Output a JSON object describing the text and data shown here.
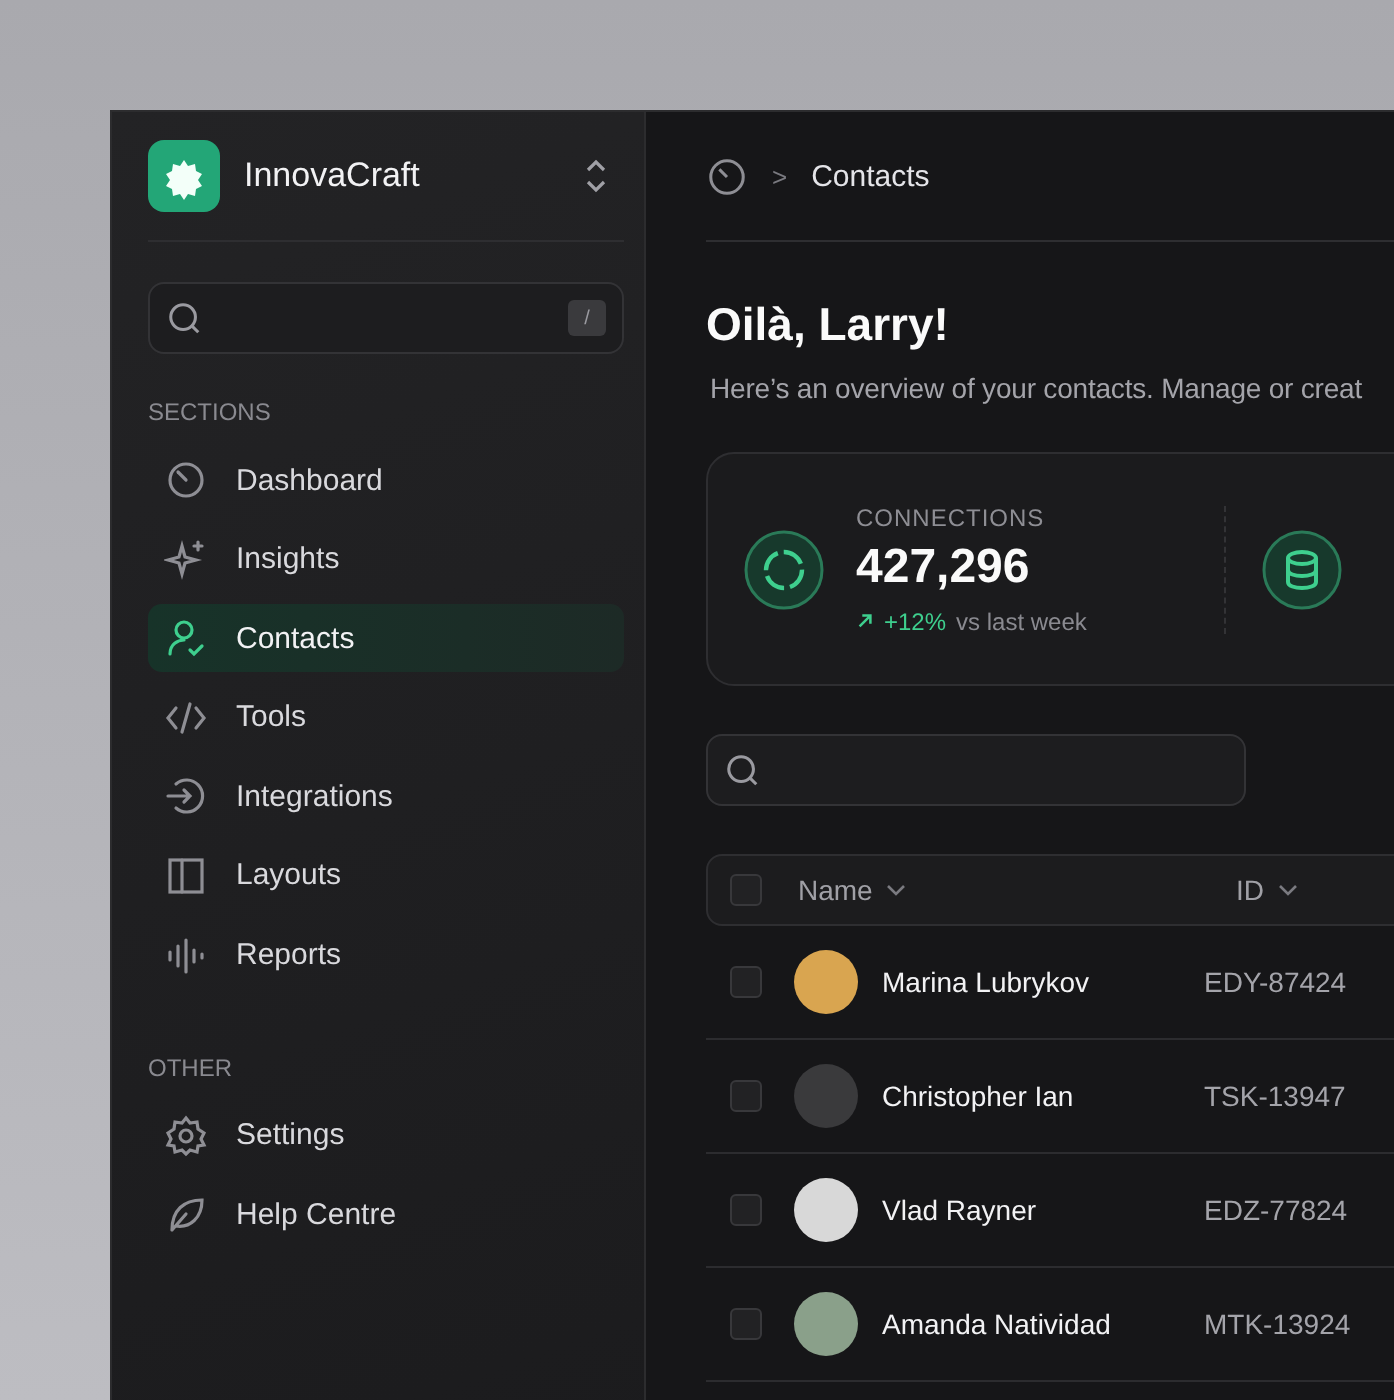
{
  "workspace": {
    "name": "InnovaCraft"
  },
  "sidebar": {
    "search": {
      "shortcut": "/"
    },
    "sections": [
      {
        "title": "SECTIONS",
        "items": [
          {
            "label": "Dashboard",
            "selected": false
          },
          {
            "label": "Insights",
            "selected": false
          },
          {
            "label": "Contacts",
            "selected": true
          },
          {
            "label": "Tools",
            "selected": false
          },
          {
            "label": "Integrations",
            "selected": false
          },
          {
            "label": "Layouts",
            "selected": false
          },
          {
            "label": "Reports",
            "selected": false
          }
        ]
      },
      {
        "title": "OTHER",
        "items": [
          {
            "label": "Settings",
            "selected": false
          },
          {
            "label": "Help Centre",
            "selected": false
          }
        ]
      }
    ]
  },
  "breadcrumb": {
    "separator": ">",
    "current": "Contacts"
  },
  "greeting": {
    "title": "Oilà, Larry!",
    "subtitle": "Here’s an overview of your contacts. Manage or creat"
  },
  "stats": [
    {
      "label": "CONNECTIONS",
      "value": "427,296",
      "change": "+12%",
      "comparison": "vs last week"
    }
  ],
  "table": {
    "header_checked": false,
    "columns": [
      {
        "label": "Name"
      },
      {
        "label": "ID"
      }
    ],
    "rows": [
      {
        "name": "Marina Lubrykov",
        "id": "EDY-87424",
        "checked": false
      },
      {
        "name": "Christopher Ian",
        "id": "TSK-13947",
        "checked": false
      },
      {
        "name": "Vlad Rayner",
        "id": "EDZ-77824",
        "checked": false
      },
      {
        "name": "Amanda Natividad",
        "id": "MTK-13924",
        "checked": false
      }
    ]
  }
}
